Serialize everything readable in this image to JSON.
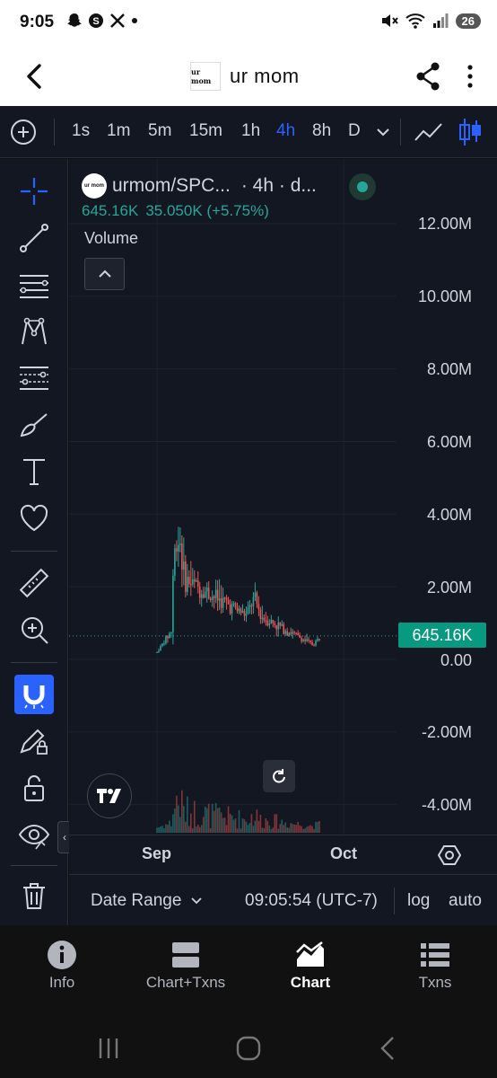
{
  "status_bar": {
    "time": "9:05",
    "icons": [
      "snapchat-icon",
      "s-app-icon",
      "x-icon",
      "dot"
    ],
    "battery": "26"
  },
  "header": {
    "token_logo_text": "ur mom",
    "title": "ur mom"
  },
  "timeframes": [
    {
      "label": "1s",
      "active": false
    },
    {
      "label": "1m",
      "active": false
    },
    {
      "label": "5m",
      "active": false
    },
    {
      "label": "15m",
      "active": false
    },
    {
      "label": "1h",
      "active": false
    },
    {
      "label": "4h",
      "active": true
    },
    {
      "label": "8h",
      "active": false
    },
    {
      "label": "D",
      "active": false
    }
  ],
  "legend": {
    "symbol": "urmom/SPC...",
    "interval": "· 4h · d...",
    "volume_value": "645.16K",
    "change": "35.050K (+5.75%)",
    "volume_label": "Volume"
  },
  "y_axis_labels": [
    "12.00M",
    "10.00M",
    "8.00M",
    "6.00M",
    "4.00M",
    "2.00M",
    "0.00",
    "-2.00M",
    "-4.00M"
  ],
  "price_tag": "645.16K",
  "time_axis": {
    "labels": [
      "Sep",
      "Oct"
    ]
  },
  "info_bar": {
    "date_range": "Date Range",
    "clock": "09:05:54 (UTC-7)",
    "log": "log",
    "auto": "auto"
  },
  "bottom_nav": [
    {
      "label": "Info",
      "icon": "info-icon",
      "active": false
    },
    {
      "label": "Chart+Txns",
      "icon": "split-icon",
      "active": false
    },
    {
      "label": "Chart",
      "icon": "chart-icon",
      "active": true
    },
    {
      "label": "Txns",
      "icon": "list-icon",
      "active": false
    }
  ],
  "colors": {
    "background": "#131722",
    "up": "#26a69a",
    "down": "#ef5350",
    "accent": "#2962ff",
    "price_tag": "#089981"
  },
  "chart_data": {
    "type": "candlestick",
    "ylim": [
      -4500000,
      13000000
    ],
    "y_ticks": [
      12000000,
      10000000,
      8000000,
      6000000,
      4000000,
      2000000,
      0,
      -2000000,
      -4000000
    ],
    "x_ticks": [
      "Sep",
      "Oct"
    ],
    "last_value": 645160,
    "segments": [
      {
        "phase": "launch",
        "from": 0,
        "to": 500000
      },
      {
        "phase": "spike",
        "peak": 3400000
      },
      {
        "phase": "decay",
        "level": 1200000
      },
      {
        "phase": "bump",
        "peak": 1600000
      },
      {
        "phase": "tail",
        "level": 400000
      },
      {
        "phase": "end",
        "level": 645160
      }
    ]
  }
}
